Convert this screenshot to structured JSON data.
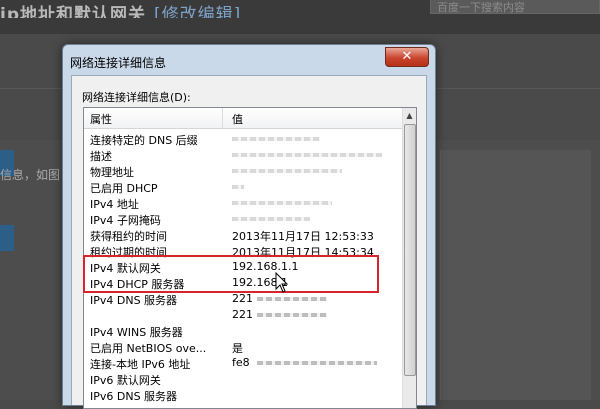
{
  "background": {
    "page_title": "ip地址和默认网关",
    "page_title_link": "[修改编辑]",
    "search_placeholder": "百度一下搜索内容",
    "snippet_text": "信息，如图"
  },
  "dialog": {
    "title": "网络连接详细信息",
    "close_label": "✕",
    "list_caption": "网络连接详细信息(D):",
    "columns": {
      "property": "属性",
      "value": "值"
    },
    "rows": [
      {
        "key": "连接特定的 DNS 后缀",
        "value": ""
      },
      {
        "key": "描述",
        "value": ""
      },
      {
        "key": "物理地址",
        "value": ""
      },
      {
        "key": "已启用 DHCP",
        "value": ""
      },
      {
        "key": "IPv4 地址",
        "value": ""
      },
      {
        "key": "IPv4 子网掩码",
        "value": ""
      },
      {
        "key": "获得租约的时间",
        "value": "2013年11月17日 12:53:33"
      },
      {
        "key": "租约过期的时间",
        "value": "2013年11月17日 14:53:34"
      },
      {
        "key": "IPv4 默认网关",
        "value": "192.168.1.1"
      },
      {
        "key": "IPv4 DHCP 服务器",
        "value": "192.168.1"
      },
      {
        "key": "IPv4 DNS 服务器",
        "value": "221"
      },
      {
        "key": "",
        "value": "221"
      },
      {
        "key": "IPv4 WINS 服务器",
        "value": ""
      },
      {
        "key": "已启用 NetBIOS ove...",
        "value": "是"
      },
      {
        "key": "连接-本地 IPv6 地址",
        "value": "fe8"
      },
      {
        "key": "IPv6 默认网关",
        "value": ""
      },
      {
        "key": "IPv6 DNS 服务器",
        "value": ""
      }
    ]
  },
  "colors": {
    "highlight_border": "#d6262b",
    "close_button": "#c9452f",
    "title_bar": "#c9d9ea"
  }
}
